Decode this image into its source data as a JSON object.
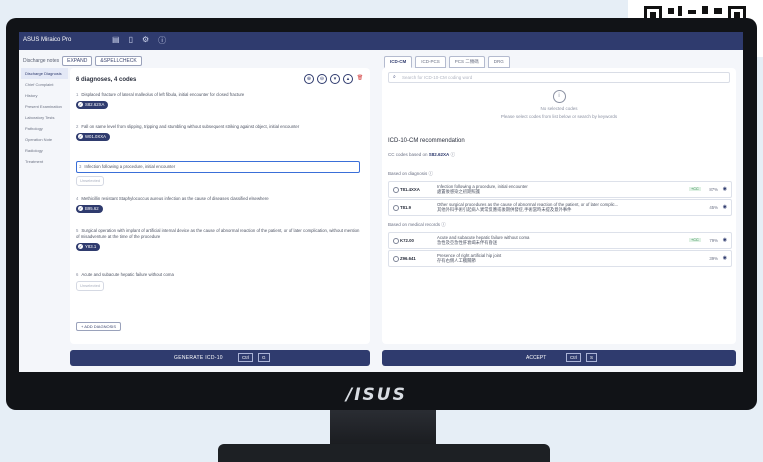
{
  "app": {
    "title": "ASUS Miraico Pro"
  },
  "left": {
    "mode_label": "Discharge notes",
    "tabs": [
      "EXPAND",
      "&SPELLCHECK"
    ],
    "nav": [
      "Discharge Diagnosis",
      "Chief Complaint",
      "History",
      "Present Examination",
      "Laboratory Tests",
      "Pathology",
      "Operation Note",
      "Radiology",
      "Treatment"
    ],
    "header": "6 diagnoses, 4 codes",
    "diagnoses": [
      {
        "num": "1",
        "text": "Displaced fracture of lateral malleolus of left fibula, initial encounter for closed fracture",
        "code": "S82.62XA"
      },
      {
        "num": "2",
        "text": "Fall on same level from slipping, tripping and stumbling without subsequent striking against object, initial encounter",
        "code": "W01.0XXA"
      },
      {
        "num": "3",
        "text": "Infection following a procedure, initial encounter",
        "code": "Unselected"
      },
      {
        "num": "4",
        "text": "Methicillin resistant Staphylococcus aureus infection as the cause of diseases classified elsewhere",
        "code": "B95.62"
      },
      {
        "num": "5",
        "text": "Surgical operation with implant of artificial internal device as the cause of abnormal reaction of the patient, or of later complication, without mention of misadventure at the time of the procedure",
        "code": "Y83.1"
      },
      {
        "num": "6",
        "text": "Acute and subacute hepatic failure without coma",
        "code": "Unselected"
      }
    ],
    "add_label": "+ ADD DIAGNOSIS",
    "bar": {
      "label": "GENERATE ICD-10",
      "k1": "Ctrl",
      "k2": "G"
    }
  },
  "right": {
    "tabs": [
      "ICD-CM",
      "ICD-PCS",
      "PCS 二類碼",
      "DRG"
    ],
    "search_placeholder": "Search for ICD-10-CM coding word",
    "empty_title": "No selected codes",
    "empty_sub": "Please select codes from list below or search by keywords",
    "rec_title": "ICD-10-CM recommendation",
    "cc_prefix": "CC codes based on",
    "cc_code": "S82.62XA",
    "group1": "Based on diagnosis",
    "group2": "Based on medical records",
    "recs": [
      {
        "code": "T81.4XXA",
        "en": "Infection following a procedure, initial encounter",
        "zh": "處置後感染之初期照護",
        "tag": "+CC",
        "pct": "87%"
      },
      {
        "code": "T81.9",
        "en": "Other surgical procedures as the cause of abnormal reaction of the patient, or of later complic...",
        "zh": "其他外科手術引起病人異常反應或後期併發症,手術當時未提及意外事件",
        "tag": "",
        "pct": "45%"
      },
      {
        "code": "K72.00",
        "en": "Acute and subacute hepatic failure without coma",
        "zh": "急性及亞急性肝衰竭未伴有昏迷",
        "tag": "+CC",
        "pct": "79%"
      },
      {
        "code": "Z96.641",
        "en": "Presence of right artificial hip joint",
        "zh": "存有右側人工髖關節",
        "tag": "",
        "pct": "39%"
      }
    ],
    "bar": {
      "label": "ACCEPT",
      "k1": "Ctrl",
      "k2": "S"
    }
  },
  "brand": "/ISUS",
  "colors": {
    "primary": "#2f3b6e",
    "accent_green": "#2d8a4a"
  }
}
